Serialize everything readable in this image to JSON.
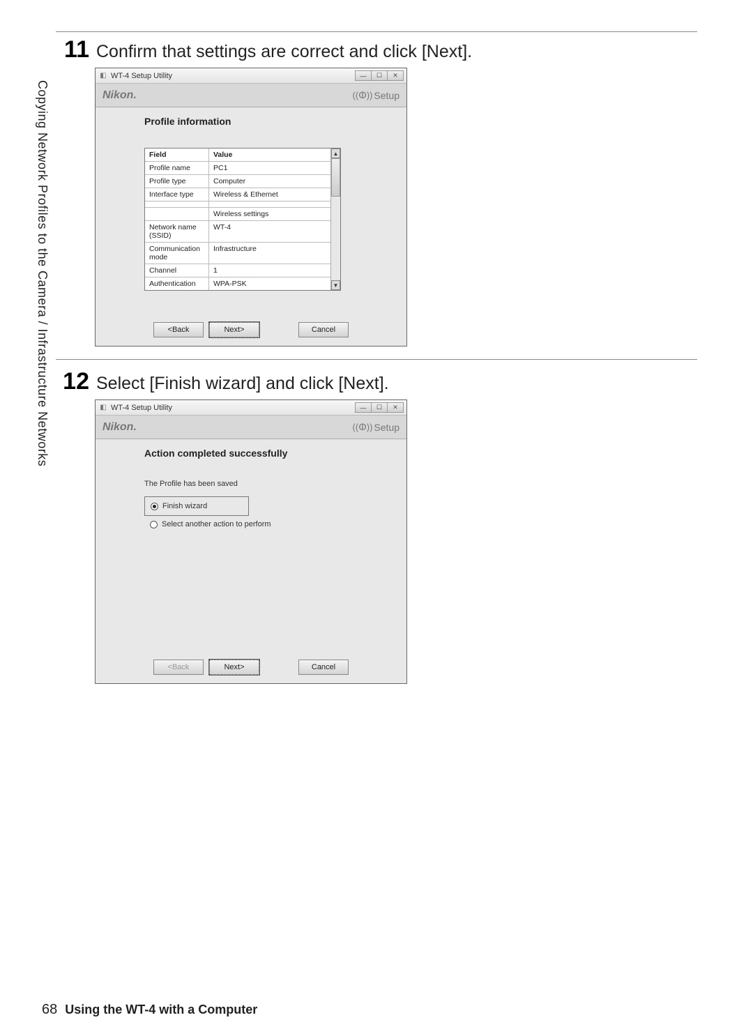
{
  "sidebar_text": "Copying Network Profiles to the Camera / Infrastructure Networks",
  "steps": {
    "s11": {
      "num": "11",
      "text": "Confirm that settings are correct and click [Next]."
    },
    "s12": {
      "num": "12",
      "text": "Select [Finish wizard] and click [Next]."
    }
  },
  "dialog1": {
    "title": "WT-4 Setup Utility",
    "brand": "Nikon.",
    "setup_label": "Setup",
    "heading": "Profile information",
    "columns": {
      "field": "Field",
      "value": "Value"
    },
    "rows": [
      {
        "field": "Profile name",
        "value": "PC1"
      },
      {
        "field": "Profile type",
        "value": "Computer"
      },
      {
        "field": "Interface type",
        "value": "Wireless & Ethernet"
      }
    ],
    "section_label": "Wireless settings",
    "rows2": [
      {
        "field": "Network name (SSID)",
        "value": "WT-4"
      },
      {
        "field": "Communication mode",
        "value": "Infrastructure"
      },
      {
        "field": "Channel",
        "value": "1"
      },
      {
        "field": "Authentication",
        "value": "WPA-PSK"
      }
    ],
    "buttons": {
      "back": "<Back",
      "next": "Next>",
      "cancel": "Cancel"
    }
  },
  "dialog2": {
    "title": "WT-4 Setup Utility",
    "brand": "Nikon.",
    "setup_label": "Setup",
    "heading": "Action completed successfully",
    "saved_text": "The Profile has been saved",
    "radio1": "Finish wizard",
    "radio2": "Select another action to perform",
    "buttons": {
      "back": "<Back",
      "next": "Next>",
      "cancel": "Cancel"
    }
  },
  "footer": {
    "page_num": "68",
    "title": "Using the WT-4 with a Computer"
  }
}
